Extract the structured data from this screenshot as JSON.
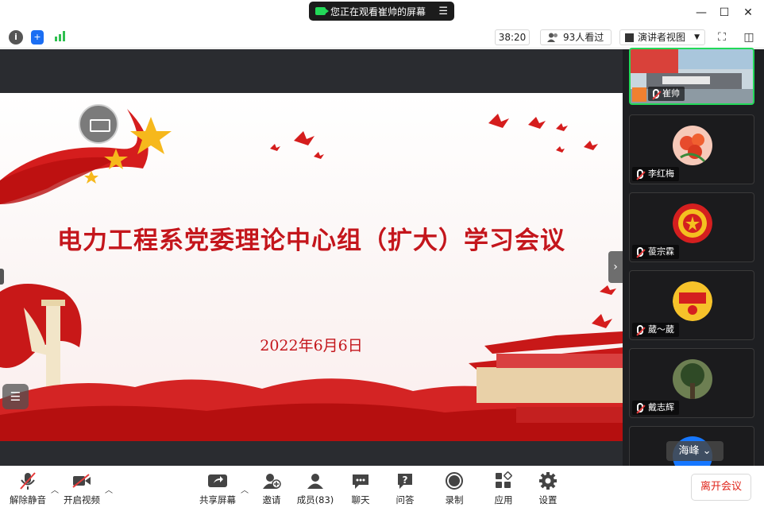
{
  "share_banner": {
    "text": "您正在观看崔帅的屏幕"
  },
  "toolbar": {
    "timer": "38:20",
    "viewers": "93人看过",
    "view_mode": "演讲者视图"
  },
  "slide": {
    "title": "电力工程系党委理论中心组（扩大）学习会议",
    "date": "2022年6月6日"
  },
  "participants": [
    {
      "name": "崔帅",
      "active": true
    },
    {
      "name": "李红梅"
    },
    {
      "name": "葰宗霖"
    },
    {
      "name": "葳～葳"
    },
    {
      "name": "戴志辉"
    }
  ],
  "gallery_overlay": "海峰",
  "bottom": {
    "unmute": "解除静音",
    "start_video": "开启视频",
    "share_screen": "共享屏幕",
    "invite": "邀请",
    "members": "成员(83)",
    "chat": "聊天",
    "qa": "问答",
    "record": "录制",
    "apps": "应用",
    "settings": "设置",
    "leave": "离开会议"
  },
  "colors": {
    "accent_green": "#23d959",
    "slide_red": "#c4161c",
    "leave_red": "#e0251b"
  }
}
